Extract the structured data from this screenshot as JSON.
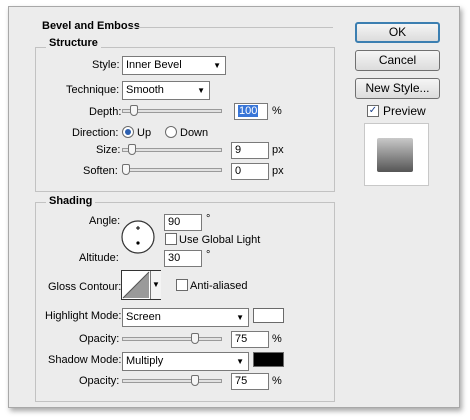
{
  "title": "Bevel and Emboss",
  "structure": {
    "header": "Structure",
    "style_label": "Style:",
    "style_value": "Inner Bevel",
    "technique_label": "Technique:",
    "technique_value": "Smooth",
    "depth_label": "Depth:",
    "depth_value": "100",
    "depth_unit": "%",
    "direction_label": "Direction:",
    "direction_up": "Up",
    "direction_down": "Down",
    "size_label": "Size:",
    "size_value": "9",
    "size_unit": "px",
    "soften_label": "Soften:",
    "soften_value": "0",
    "soften_unit": "px"
  },
  "shading": {
    "header": "Shading",
    "angle_label": "Angle:",
    "angle_value": "90",
    "angle_unit": "°",
    "use_global_light_label": "Use Global Light",
    "altitude_label": "Altitude:",
    "altitude_value": "30",
    "altitude_unit": "°",
    "gloss_contour_label": "Gloss Contour:",
    "anti_aliased_label": "Anti-aliased",
    "highlight_mode_label": "Highlight Mode:",
    "highlight_mode_value": "Screen",
    "highlight_color": "#ffffff",
    "highlight_opacity_label": "Opacity:",
    "highlight_opacity_value": "75",
    "highlight_opacity_unit": "%",
    "shadow_mode_label": "Shadow Mode:",
    "shadow_mode_value": "Multiply",
    "shadow_color": "#000000",
    "shadow_opacity_label": "Opacity:",
    "shadow_opacity_value": "75",
    "shadow_opacity_unit": "%"
  },
  "buttons": {
    "ok": "OK",
    "cancel": "Cancel",
    "new_style": "New Style...",
    "preview_label": "Preview"
  }
}
